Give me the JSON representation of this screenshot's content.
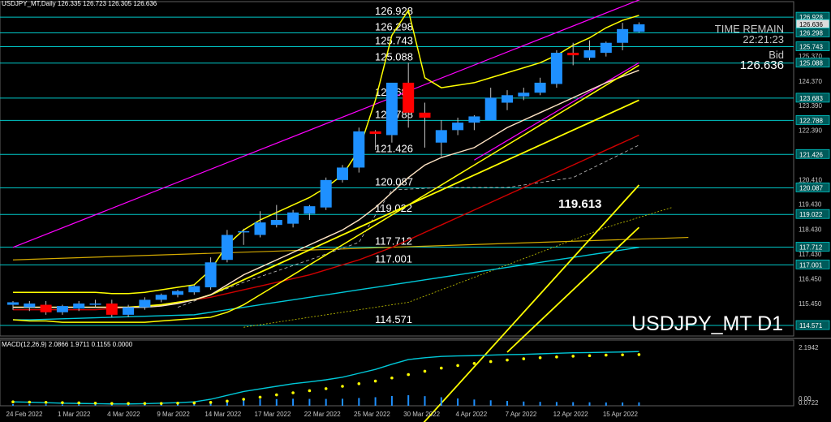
{
  "header": {
    "symbol_line": "USDJPY_MT,Daily  126.335 126.723 126.305 126.636",
    "macd_line": "MACD(12,26,9) 2.0866 1.9711 0.1155 0.0000"
  },
  "info": {
    "time_remain_label": "TIME REMAIN",
    "time_remain_value": "22:21:23",
    "bid_label": "Bid",
    "bid_value": "126.636",
    "symbol_big": "USDJPY_MT D1"
  },
  "colors": {
    "background": "#000000",
    "bull": "#1e90ff",
    "bear": "#ff0000",
    "level_line": "#00c8c8",
    "envelope": "#ffff00",
    "ma_white": "#ffe4c4",
    "ma_red": "#d00000",
    "ma_cyan": "#00c8d8",
    "channel": "#ff00ff",
    "gold_line": "#d4aa00",
    "macd_line": "#00c8d8",
    "macd_signal": "#ffff00",
    "macd_hist": "#1e90ff"
  },
  "chart_data": [
    {
      "type": "candlestick",
      "title": "USDJPY_MT,Daily",
      "ylim": [
        114.15,
        127.55
      ],
      "price_ticks": [
        "126.928",
        "126.636",
        "126.298",
        "125.743",
        "125.370",
        "125.088",
        "124.370",
        "123.683",
        "123.390",
        "122.788",
        "122.390",
        "121.426",
        "120.410",
        "120.087",
        "119.430",
        "119.022",
        "118.430",
        "117.712",
        "117.430",
        "117.001",
        "116.450",
        "115.450",
        "114.571"
      ],
      "date_labels": [
        "24 Feb 2022",
        "1 Mar 2022",
        "4 Mar 2022",
        "9 Mar 2022",
        "14 Mar 2022",
        "17 Mar 2022",
        "22 Mar 2022",
        "25 Mar 2022",
        "30 Mar 2022",
        "4 Apr 2022",
        "7 Apr 2022",
        "12 Apr 2022",
        "15 Apr 2022"
      ],
      "levels": [
        126.928,
        126.298,
        125.743,
        125.088,
        123.683,
        122.788,
        121.426,
        120.087,
        119.022,
        117.712,
        117.001,
        114.571
      ],
      "level_labels": [
        "126.928",
        "126.298",
        "125.743",
        "125.088",
        "123.683",
        "122.788",
        "121.426",
        "120.087",
        "119.022",
        "117.712",
        "117.001",
        "114.571"
      ],
      "price_highlights": [
        "126.636"
      ],
      "annotation": "119.613",
      "candles": [
        {
          "o": 115.4,
          "h": 115.55,
          "l": 115.2,
          "c": 115.5
        },
        {
          "o": 115.3,
          "h": 115.55,
          "l": 115.15,
          "c": 115.45
        },
        {
          "o": 115.4,
          "h": 115.55,
          "l": 115.0,
          "c": 115.1
        },
        {
          "o": 115.1,
          "h": 115.4,
          "l": 115.0,
          "c": 115.35
        },
        {
          "o": 115.25,
          "h": 115.55,
          "l": 115.15,
          "c": 115.45
        },
        {
          "o": 115.4,
          "h": 115.6,
          "l": 115.3,
          "c": 115.45
        },
        {
          "o": 115.45,
          "h": 115.6,
          "l": 114.9,
          "c": 115.0
        },
        {
          "o": 115.0,
          "h": 115.4,
          "l": 114.9,
          "c": 115.3
        },
        {
          "o": 115.3,
          "h": 115.7,
          "l": 115.2,
          "c": 115.6
        },
        {
          "o": 115.6,
          "h": 115.85,
          "l": 115.5,
          "c": 115.8
        },
        {
          "o": 115.8,
          "h": 116.0,
          "l": 115.7,
          "c": 115.95
        },
        {
          "o": 115.9,
          "h": 116.2,
          "l": 115.8,
          "c": 116.15
        },
        {
          "o": 116.1,
          "h": 117.3,
          "l": 116.0,
          "c": 117.1
        },
        {
          "o": 117.2,
          "h": 118.4,
          "l": 117.1,
          "c": 118.2
        },
        {
          "o": 118.3,
          "h": 118.45,
          "l": 117.8,
          "c": 118.35
        },
        {
          "o": 118.2,
          "h": 119.15,
          "l": 118.1,
          "c": 118.7
        },
        {
          "o": 118.6,
          "h": 119.4,
          "l": 118.5,
          "c": 118.8
        },
        {
          "o": 118.65,
          "h": 119.2,
          "l": 118.5,
          "c": 119.1
        },
        {
          "o": 119.05,
          "h": 119.4,
          "l": 118.8,
          "c": 119.35
        },
        {
          "o": 119.3,
          "h": 120.5,
          "l": 119.2,
          "c": 120.4
        },
        {
          "o": 120.4,
          "h": 121.0,
          "l": 120.3,
          "c": 120.9
        },
        {
          "o": 120.9,
          "h": 122.5,
          "l": 120.7,
          "c": 122.35
        },
        {
          "o": 122.35,
          "h": 122.4,
          "l": 121.6,
          "c": 122.25
        },
        {
          "o": 122.2,
          "h": 123.85,
          "l": 121.9,
          "c": 124.3
        },
        {
          "o": 124.3,
          "h": 125.1,
          "l": 122.5,
          "c": 123.1
        },
        {
          "o": 123.1,
          "h": 123.5,
          "l": 121.7,
          "c": 122.9
        },
        {
          "o": 121.9,
          "h": 122.8,
          "l": 121.35,
          "c": 122.4
        },
        {
          "o": 122.4,
          "h": 122.9,
          "l": 122.2,
          "c": 122.7
        },
        {
          "o": 122.7,
          "h": 123.0,
          "l": 122.4,
          "c": 122.95
        },
        {
          "o": 122.8,
          "h": 124.1,
          "l": 122.8,
          "c": 123.7
        },
        {
          "o": 123.5,
          "h": 124.0,
          "l": 123.2,
          "c": 123.8
        },
        {
          "o": 123.75,
          "h": 124.1,
          "l": 123.6,
          "c": 123.9
        },
        {
          "o": 123.9,
          "h": 124.5,
          "l": 123.8,
          "c": 124.3
        },
        {
          "o": 124.25,
          "h": 125.6,
          "l": 124.1,
          "c": 125.5
        },
        {
          "o": 125.5,
          "h": 125.9,
          "l": 125.0,
          "c": 125.4
        },
        {
          "o": 125.3,
          "h": 126.0,
          "l": 125.2,
          "c": 125.6
        },
        {
          "o": 125.5,
          "h": 125.95,
          "l": 125.35,
          "c": 125.9
        },
        {
          "o": 125.9,
          "h": 126.7,
          "l": 125.6,
          "c": 126.45
        },
        {
          "o": 126.34,
          "h": 126.72,
          "l": 126.31,
          "c": 126.64
        }
      ],
      "channel_upper": [
        [
          0,
          117.7
        ],
        [
          41,
          128.4
        ]
      ],
      "channel_lower": [
        [
          28,
          121.2
        ],
        [
          38,
          125.1
        ]
      ],
      "gold_line": [
        [
          0,
          117.2
        ],
        [
          41,
          118.1
        ]
      ],
      "ma_white": [
        115.3,
        115.3,
        115.3,
        115.3,
        115.3,
        115.3,
        115.3,
        115.3,
        115.3,
        115.35,
        115.45,
        115.6,
        115.8,
        116.2,
        116.6,
        116.9,
        117.2,
        117.5,
        117.8,
        118.1,
        118.4,
        118.8,
        119.3,
        119.9,
        120.5,
        121.0,
        121.3,
        121.5,
        121.7,
        122.1,
        122.5,
        122.8,
        123.1,
        123.4,
        123.7,
        124.0,
        124.3,
        124.55,
        124.8
      ],
      "ma_red": [
        115.2,
        115.2,
        115.2,
        115.2,
        115.2,
        115.2,
        115.25,
        115.3,
        115.35,
        115.4,
        115.5,
        115.6,
        115.7,
        115.85,
        116.0,
        116.15,
        116.3,
        116.45,
        116.6,
        116.8,
        117.0,
        117.2,
        117.45,
        117.7,
        118.0,
        118.3,
        118.6,
        118.9,
        119.2,
        119.5,
        119.8,
        120.1,
        120.4,
        120.7,
        121.0,
        121.3,
        121.6,
        121.9,
        122.2
      ],
      "ma_fast_yellow": [
        115.3,
        115.3,
        115.3,
        115.3,
        115.3,
        115.3,
        115.3,
        115.3,
        115.35,
        115.4,
        115.5,
        115.6,
        115.8,
        116.1,
        116.4,
        116.7,
        117.0,
        117.3,
        117.6,
        117.9,
        118.2,
        118.5,
        118.8,
        119.1,
        119.4,
        119.7,
        120.0,
        120.3,
        120.6,
        120.9,
        121.2,
        121.5,
        121.8,
        122.1,
        122.4,
        122.7,
        123.0,
        123.3,
        123.6
      ],
      "ma_cyan": [
        114.8,
        114.8,
        114.82,
        114.84,
        114.86,
        114.88,
        114.9,
        114.92,
        114.94,
        114.96,
        114.98,
        115.0,
        115.1,
        115.2,
        115.3,
        115.4,
        115.5,
        115.6,
        115.7,
        115.8,
        115.9,
        116.0,
        116.1,
        116.2,
        116.3,
        116.4,
        116.5,
        116.6,
        116.7,
        116.8,
        116.9,
        117.0,
        117.1,
        117.2,
        117.3,
        117.4,
        117.5,
        117.6,
        117.7
      ],
      "env_upper": [
        115.9,
        115.9,
        115.9,
        115.9,
        115.9,
        115.9,
        115.85,
        115.85,
        115.9,
        116.0,
        116.1,
        116.2,
        116.8,
        117.8,
        118.4,
        118.8,
        119.1,
        119.4,
        119.7,
        120.1,
        120.6,
        121.6,
        123.6,
        126.2,
        127.2,
        124.5,
        124.1,
        124.2,
        124.3,
        124.5,
        124.7,
        124.9,
        125.1,
        125.4,
        125.8,
        126.1,
        126.5,
        126.8,
        127.0
      ],
      "env_lower": [
        114.8,
        114.75,
        114.75,
        114.7,
        114.7,
        114.7,
        114.7,
        114.7,
        114.7,
        114.75,
        114.8,
        114.85,
        114.9,
        115.1,
        115.4,
        115.8,
        116.2,
        116.6,
        117.0,
        117.4,
        117.8,
        118.2,
        118.6,
        119.0,
        119.4,
        119.8,
        120.2,
        120.6,
        121.0,
        121.4,
        121.8,
        122.2,
        122.6,
        123.0,
        123.4,
        123.8,
        124.2,
        124.6,
        125.0
      ],
      "extra_yellow_1": [
        [
          24,
          110.0
        ],
        [
          38,
          120.2
        ]
      ],
      "extra_yellow_2": [
        [
          30,
          113.5
        ],
        [
          38,
          118.5
        ]
      ],
      "dashed_ma": [
        [
          10,
          115.3
        ],
        [
          14,
          116.3
        ],
        [
          18,
          117.2
        ],
        [
          21,
          117.9
        ],
        [
          22,
          119.0
        ],
        [
          23,
          120.0
        ],
        [
          26,
          120.1
        ],
        [
          30,
          120.1
        ],
        [
          34,
          120.5
        ],
        [
          38,
          121.8
        ]
      ],
      "dotted_yellow": [
        [
          14,
          114.5
        ],
        [
          24,
          115.5
        ],
        [
          30,
          117.0
        ],
        [
          36,
          118.5
        ],
        [
          40,
          119.3
        ]
      ]
    },
    {
      "type": "macd",
      "title": "MACD(12,26,9)",
      "params": [
        12,
        26,
        9
      ],
      "values_shown": [
        2.0866,
        1.9711,
        0.1155,
        0.0
      ],
      "ylim": [
        0.0,
        2.25
      ],
      "ticks": [
        "2.1942",
        "0.0722",
        "0.00"
      ],
      "macd": [
        0.15,
        0.14,
        0.12,
        0.1,
        0.09,
        0.08,
        0.07,
        0.07,
        0.08,
        0.1,
        0.12,
        0.15,
        0.25,
        0.4,
        0.55,
        0.65,
        0.75,
        0.85,
        0.92,
        1.0,
        1.1,
        1.25,
        1.4,
        1.6,
        1.78,
        1.85,
        1.9,
        1.92,
        1.93,
        1.95,
        1.97,
        1.98,
        2.0,
        2.02,
        2.04,
        2.05,
        2.06,
        2.07,
        2.0866
      ],
      "signal": [
        0.15,
        0.14,
        0.13,
        0.12,
        0.11,
        0.1,
        0.09,
        0.09,
        0.09,
        0.09,
        0.1,
        0.11,
        0.13,
        0.18,
        0.25,
        0.33,
        0.42,
        0.5,
        0.58,
        0.66,
        0.75,
        0.85,
        0.95,
        1.07,
        1.2,
        1.33,
        1.45,
        1.55,
        1.63,
        1.7,
        1.76,
        1.81,
        1.85,
        1.88,
        1.91,
        1.93,
        1.95,
        1.96,
        1.9711
      ],
      "hist_max": 0.95
    }
  ]
}
